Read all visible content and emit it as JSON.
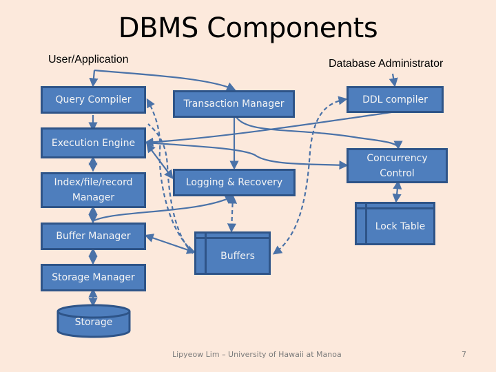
{
  "slide": {
    "title": "DBMS Components",
    "page_number": "7",
    "footer": "Lipyeow Lim – University of Hawaii at Manoa"
  },
  "actors": {
    "user": "User/Application",
    "dba": "Database Administrator"
  },
  "components": {
    "query_compiler": "Query Compiler",
    "transaction_manager": "Transaction Manager",
    "ddl_compiler": "DDL compiler",
    "execution_engine": "Execution Engine",
    "index_manager_line1": "Index/file/record",
    "index_manager_line2": "Manager",
    "logging_recovery": "Logging & Recovery",
    "concurrency_control_line1": "Concurrency",
    "concurrency_control_line2": "Control",
    "lock_table": "Lock Table",
    "buffer_manager": "Buffer Manager",
    "buffers": "Buffers",
    "storage_manager": "Storage Manager",
    "storage": "Storage"
  },
  "colors": {
    "background": "#fce9dc",
    "box_fill": "#4e7ebd",
    "box_border": "#2e5488",
    "connector": "#4a72a8"
  }
}
